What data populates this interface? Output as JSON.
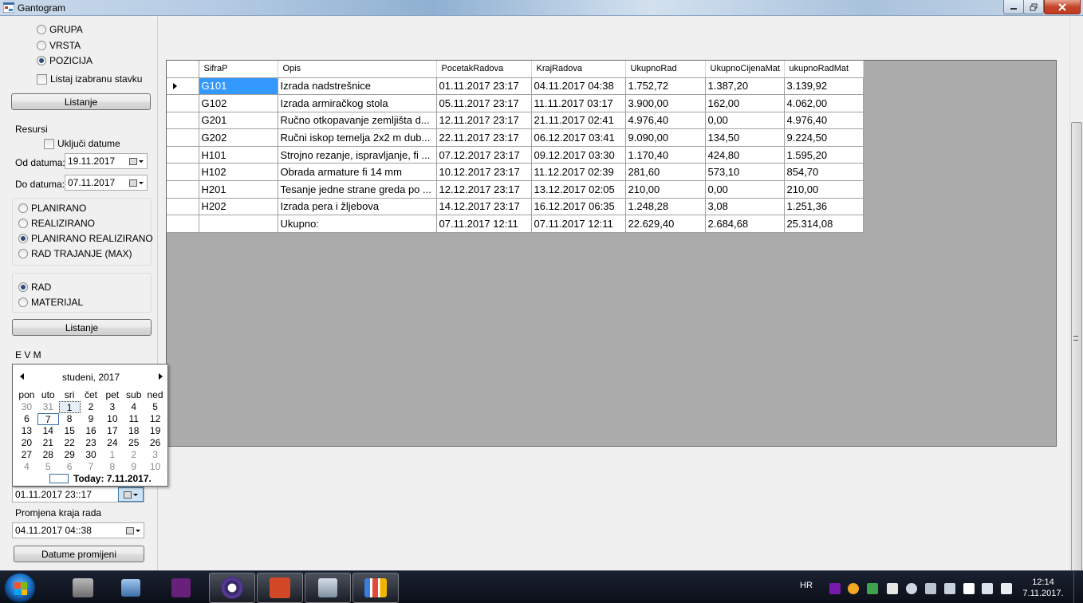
{
  "window": {
    "title": "Gantogram",
    "controls": {
      "minimize": "–",
      "maximize": "□",
      "close": "✕"
    }
  },
  "left_panel": {
    "view_options": [
      {
        "label": "GRUPA",
        "selected": false
      },
      {
        "label": "VRSTA",
        "selected": false
      },
      {
        "label": "POZICIJA",
        "selected": true
      }
    ],
    "list_selected_label": "Listaj izabranu stavku",
    "list_button_1": "Listanje",
    "resources_label": "Resursi",
    "include_dates_label": "Uključi datume",
    "from_date_label": "Od datuma:",
    "from_date_value": "19.11.2017",
    "to_date_label": "Do datuma:",
    "to_date_value": "07.11.2017",
    "plan_options": [
      {
        "label": "PLANIRANO",
        "selected": false
      },
      {
        "label": "REALIZIRANO",
        "selected": false
      },
      {
        "label": "PLANIRANO REALIZIRANO",
        "selected": true
      },
      {
        "label": "RAD TRAJANJE (MAX)",
        "selected": false
      }
    ],
    "type_options": [
      {
        "label": "RAD",
        "selected": true
      },
      {
        "label": "MATERIJAL",
        "selected": false
      }
    ],
    "list_button_2": "Listanje",
    "evm_label": "E V M",
    "start_change_value": "01.11.2017 23::17",
    "end_change_label": "Promjena kraja rada",
    "end_change_value": "04.11.2017 04::38",
    "change_dates_button": "Datume promijeni"
  },
  "calendar": {
    "month_title": "studeni, 2017",
    "day_names": [
      "pon",
      "uto",
      "sri",
      "čet",
      "pet",
      "sub",
      "ned"
    ],
    "weeks": [
      [
        "30",
        "31",
        "1",
        "2",
        "3",
        "4",
        "5"
      ],
      [
        "6",
        "7",
        "8",
        "9",
        "10",
        "11",
        "12"
      ],
      [
        "13",
        "14",
        "15",
        "16",
        "17",
        "18",
        "19"
      ],
      [
        "20",
        "21",
        "22",
        "23",
        "24",
        "25",
        "26"
      ],
      [
        "27",
        "28",
        "29",
        "30",
        "1",
        "2",
        "3"
      ],
      [
        "4",
        "5",
        "6",
        "7",
        "8",
        "9",
        "10"
      ]
    ],
    "today_label": "Today: 7.11.2017."
  },
  "grid": {
    "columns": [
      "SifraP",
      "Opis",
      "PocetakRadova",
      "KrajRadova",
      "UkupnoRad",
      "UkupnoCijenaMat",
      "ukupnoRadMat"
    ],
    "rows": [
      [
        "G101",
        "Izrada nadstrešnice",
        "01.11.2017 23:17",
        "04.11.2017 04:38",
        "1.752,72",
        "1.387,20",
        "3.139,92"
      ],
      [
        "G102",
        "Izrada armiračkog stola",
        "05.11.2017 23:17",
        "11.11.2017 03:17",
        "3.900,00",
        "162,00",
        "4.062,00"
      ],
      [
        "G201",
        "Ručno otkopavanje zemljišta d...",
        "12.11.2017 23:17",
        "21.11.2017 02:41",
        "4.976,40",
        "0,00",
        "4.976,40"
      ],
      [
        "G202",
        "Ručni iskop temelja 2x2 m dub...",
        "22.11.2017 23:17",
        "06.12.2017 03:41",
        "9.090,00",
        "134,50",
        "9.224,50"
      ],
      [
        "H101",
        "Strojno rezanje, ispravljanje, fi ...",
        "07.12.2017 23:17",
        "09.12.2017 03:30",
        "1.170,40",
        "424,80",
        "1.595,20"
      ],
      [
        "H102",
        "Obrada armature fi 14 mm",
        "10.12.2017 23:17",
        "11.12.2017 02:39",
        "281,60",
        "573,10",
        "854,70"
      ],
      [
        "H201",
        "Tesanje jedne strane greda po ...",
        "12.12.2017 23:17",
        "13.12.2017 02:05",
        "210,00",
        "0,00",
        "210,00"
      ],
      [
        "H202",
        "Izrada pera i žljebova",
        "14.12.2017 23:17",
        "16.12.2017 06:35",
        "1.248,28",
        "3,08",
        "1.251,36"
      ],
      [
        "",
        "Ukupno:",
        "07.11.2017 12:11",
        "07.11.2017 12:11",
        "22.629,40",
        "2.684,68",
        "25.314,08"
      ]
    ]
  },
  "taskbar": {
    "language": "HR",
    "time": "12:14",
    "date": "7.11.2017."
  },
  "colors": {
    "selection": "#3399ff",
    "grid_background": "#ababab",
    "taskbar": "#0b0f18"
  }
}
